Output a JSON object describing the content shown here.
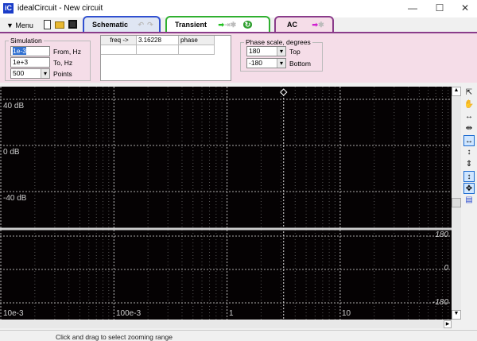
{
  "window": {
    "title": "idealCircuit - New circuit",
    "app_icon": "iC",
    "minimize": "—",
    "maximize": "☐",
    "close": "✕"
  },
  "toolbar": {
    "menu_label": "Menu"
  },
  "tabs": [
    {
      "label": "Schematic",
      "color": "#3050d0"
    },
    {
      "label": "Transient",
      "color": "#30b030"
    },
    {
      "label": "AC",
      "color": "#8a3c8a"
    }
  ],
  "simulation": {
    "legend": "Simulation",
    "from_value": "1e-3",
    "from_label": "From, Hz",
    "to_value": "1e+3",
    "to_label": "To, Hz",
    "points_value": "500",
    "points_label": "Points"
  },
  "results_grid": {
    "headers": [
      "freq ->",
      "3.16228",
      "phase"
    ]
  },
  "phase_scale": {
    "legend": "Phase scale, degrees",
    "top_value": "180",
    "top_label": "Top",
    "bottom_value": "-180",
    "bottom_label": "Bottom"
  },
  "plot": {
    "magnitude_labels": [
      "40 dB",
      "0 dB",
      "-40 dB"
    ],
    "phase_labels": [
      "180",
      "0",
      "-180"
    ],
    "x_labels": [
      "10e-3",
      "100e-3",
      "1",
      "10"
    ],
    "cursor_freq": 3.16228
  },
  "status": {
    "text": "Click and drag to select zooming range"
  }
}
